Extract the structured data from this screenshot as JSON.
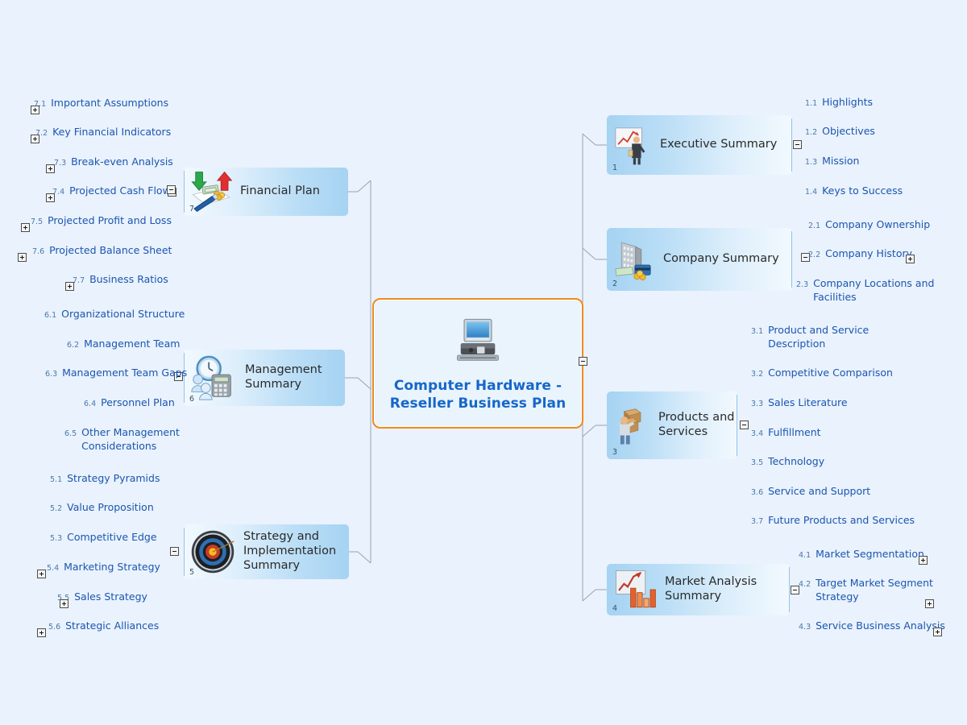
{
  "colors": {
    "background": "#eaf2fd",
    "central_border": "#f08a1c",
    "central_text": "#1667c8",
    "branch_fill_start": "#a5d3f2",
    "branch_fill_end": "#f2f9fe",
    "leaf_text": "#1a56b0",
    "leaf_number": "#4a79ad",
    "connector": "#9aa4ad"
  },
  "central": {
    "title": "Computer Hardware -\nReseller Business Plan",
    "icon": "desktop-computer-icon",
    "toggle": "minus"
  },
  "branches": [
    {
      "number": "1",
      "label": "Executive Summary",
      "icon": "presenter-chart-icon",
      "side": "right",
      "toggle": "minus",
      "children": [
        {
          "number": "1.1",
          "label": "Highlights",
          "toggle": null
        },
        {
          "number": "1.2",
          "label": "Objectives",
          "toggle": null
        },
        {
          "number": "1.3",
          "label": "Mission",
          "toggle": null
        },
        {
          "number": "1.4",
          "label": "Keys to Success",
          "toggle": null
        }
      ]
    },
    {
      "number": "2",
      "label": "Company Summary",
      "icon": "office-building-money-icon",
      "side": "right",
      "toggle": "minus",
      "children": [
        {
          "number": "2.1",
          "label": "Company Ownership",
          "toggle": null
        },
        {
          "number": "2.2",
          "label": "Company History",
          "toggle": "plus"
        },
        {
          "number": "2.3",
          "label": "Company Locations and\nFacilities",
          "toggle": null
        }
      ]
    },
    {
      "number": "3",
      "label": "Products and\nServices",
      "icon": "person-carrying-boxes-icon",
      "side": "right",
      "toggle": "minus",
      "children": [
        {
          "number": "3.1",
          "label": "Product and Service\nDescription",
          "toggle": null
        },
        {
          "number": "3.2",
          "label": "Competitive Comparison",
          "toggle": null
        },
        {
          "number": "3.3",
          "label": "Sales Literature",
          "toggle": null
        },
        {
          "number": "3.4",
          "label": "Fulfillment",
          "toggle": null
        },
        {
          "number": "3.5",
          "label": "Technology",
          "toggle": null
        },
        {
          "number": "3.6",
          "label": "Service and Support",
          "toggle": null
        },
        {
          "number": "3.7",
          "label": "Future Products and Services",
          "toggle": null
        }
      ]
    },
    {
      "number": "4",
      "label": "Market Analysis\nSummary",
      "icon": "bar-chart-growth-icon",
      "side": "right",
      "toggle": "minus",
      "children": [
        {
          "number": "4.1",
          "label": "Market Segmentation",
          "toggle": "plus"
        },
        {
          "number": "4.2",
          "label": "Target Market Segment\nStrategy",
          "toggle": "plus"
        },
        {
          "number": "4.3",
          "label": "Service Business Analysis",
          "toggle": "plus"
        }
      ]
    },
    {
      "number": "5",
      "label": "Strategy and\nImplementation\nSummary",
      "icon": "target-bullseye-icon",
      "side": "left",
      "toggle": "minus",
      "children": [
        {
          "number": "5.1",
          "label": "Strategy Pyramids",
          "toggle": null
        },
        {
          "number": "5.2",
          "label": "Value Proposition",
          "toggle": null
        },
        {
          "number": "5.3",
          "label": "Competitive Edge",
          "toggle": null
        },
        {
          "number": "5.4",
          "label": "Marketing Strategy",
          "toggle": "plus"
        },
        {
          "number": "5.5",
          "label": "Sales Strategy",
          "toggle": "plus"
        },
        {
          "number": "5.6",
          "label": "Strategic Alliances",
          "toggle": "plus"
        }
      ]
    },
    {
      "number": "6",
      "label": "Management\nSummary",
      "icon": "clock-people-calculator-icon",
      "side": "left",
      "toggle": "minus",
      "children": [
        {
          "number": "6.1",
          "label": "Organizational Structure",
          "toggle": null
        },
        {
          "number": "6.2",
          "label": "Management Team",
          "toggle": null
        },
        {
          "number": "6.3",
          "label": "Management Team Gaps",
          "toggle": null
        },
        {
          "number": "6.4",
          "label": "Personnel Plan",
          "toggle": null
        },
        {
          "number": "6.5",
          "label": "Other Management\nConsiderations",
          "toggle": null
        }
      ]
    },
    {
      "number": "7",
      "label": "Financial Plan",
      "icon": "money-arrows-pen-icon",
      "side": "left",
      "toggle": "minus",
      "children": [
        {
          "number": "7.1",
          "label": "Important Assumptions",
          "toggle": "plus"
        },
        {
          "number": "7.2",
          "label": "Key Financial Indicators",
          "toggle": "plus"
        },
        {
          "number": "7.3",
          "label": "Break-even Analysis",
          "toggle": "plus"
        },
        {
          "number": "7.4",
          "label": "Projected Cash Flow",
          "toggle": "plus"
        },
        {
          "number": "7.5",
          "label": "Projected Profit and Loss",
          "toggle": "plus"
        },
        {
          "number": "7.6",
          "label": "Projected Balance Sheet",
          "toggle": "plus"
        },
        {
          "number": "7.7",
          "label": "Business Ratios",
          "toggle": "plus"
        }
      ]
    }
  ]
}
